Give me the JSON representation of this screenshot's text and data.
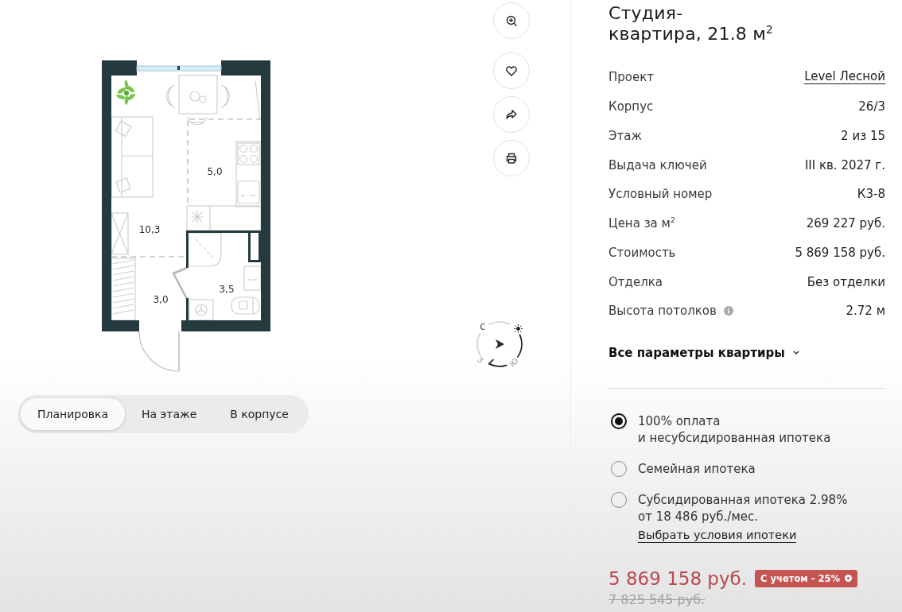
{
  "plan": {
    "rooms": [
      {
        "area": "5,0"
      },
      {
        "area": "10,3"
      },
      {
        "area": "3,5"
      },
      {
        "area": "3,0"
      }
    ]
  },
  "compass": {
    "north": "С",
    "west": "З",
    "south": "Ю"
  },
  "view_tabs": [
    {
      "label": "Планировка",
      "selected": true
    },
    {
      "label": "На этаже",
      "selected": false
    },
    {
      "label": "В корпусе",
      "selected": false
    }
  ],
  "apartment": {
    "title": "Студия-квартира, 21.8 м$^{2}$"
  },
  "params": [
    {
      "kind": "link",
      "label": "Проект",
      "value": "Level Лесной"
    },
    {
      "kind": "text",
      "label": "Корпус",
      "value": "26/3"
    },
    {
      "kind": "text",
      "label": "Этаж",
      "value": "2 из 15"
    },
    {
      "kind": "text",
      "label": "Выдача ключей",
      "value": "III кв. 2027 г."
    },
    {
      "kind": "text",
      "label": "Условный номер",
      "value": "К3-8"
    },
    {
      "kind": "text",
      "label": "Цена за м$^{2}$",
      "value": "269 227 руб."
    },
    {
      "kind": "text",
      "label": "Стоимость",
      "value": "5 869 158 руб."
    },
    {
      "kind": "text",
      "label": "Отделка",
      "value": "Без отделки"
    },
    {
      "kind": "hint",
      "label": "Высота потолков",
      "value": "2.72 м"
    }
  ],
  "all_params": {
    "label": "Все параметры квартиры",
    "expanded": false
  },
  "payment_options": [
    {
      "label": "100% оплата\nи несубсидированная ипотека",
      "selected": true
    },
    {
      "label": "Семейная ипотека",
      "selected": false
    },
    {
      "label": "Субсидированная ипотека 2.98%",
      "detail": "от 18 486 руб./мес.",
      "link": "Выбрать условия ипотеки",
      "selected": false
    }
  ],
  "price": {
    "current": "5 869 158 руб.",
    "discount": "С учетом - 25%",
    "old": "7 825 545 руб."
  }
}
